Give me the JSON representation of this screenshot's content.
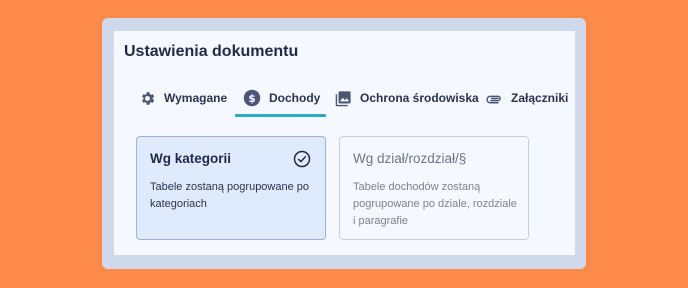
{
  "dialog": {
    "title": "Ustawienia dokumentu"
  },
  "tabs": [
    {
      "label": "Wymagane",
      "icon": "gear-icon",
      "active": false
    },
    {
      "label": "Dochody",
      "icon": "dollar-circle-icon",
      "active": true
    },
    {
      "label": "Ochrona środowiska",
      "icon": "image-icon",
      "active": false
    },
    {
      "label": "Załączniki",
      "icon": "paperclip-icon",
      "active": false
    }
  ],
  "options": [
    {
      "title": "Wg kategorii",
      "description": "Tabele zostaną pogrupowane po kategoriach",
      "selected": true
    },
    {
      "title": "Wg dział/rozdział/§",
      "description": "Tabele dochodów zostaną pogrupowane po dziale, rozdziale i paragrafie",
      "selected": false
    }
  ],
  "colors": {
    "background": "#FE8A4A",
    "frame": "#CFD9EC",
    "panel": "#F5F8FE",
    "accent": "#2AA9CF",
    "selected_card": "#DFEAFD",
    "text_primary": "#1E2A4A"
  }
}
